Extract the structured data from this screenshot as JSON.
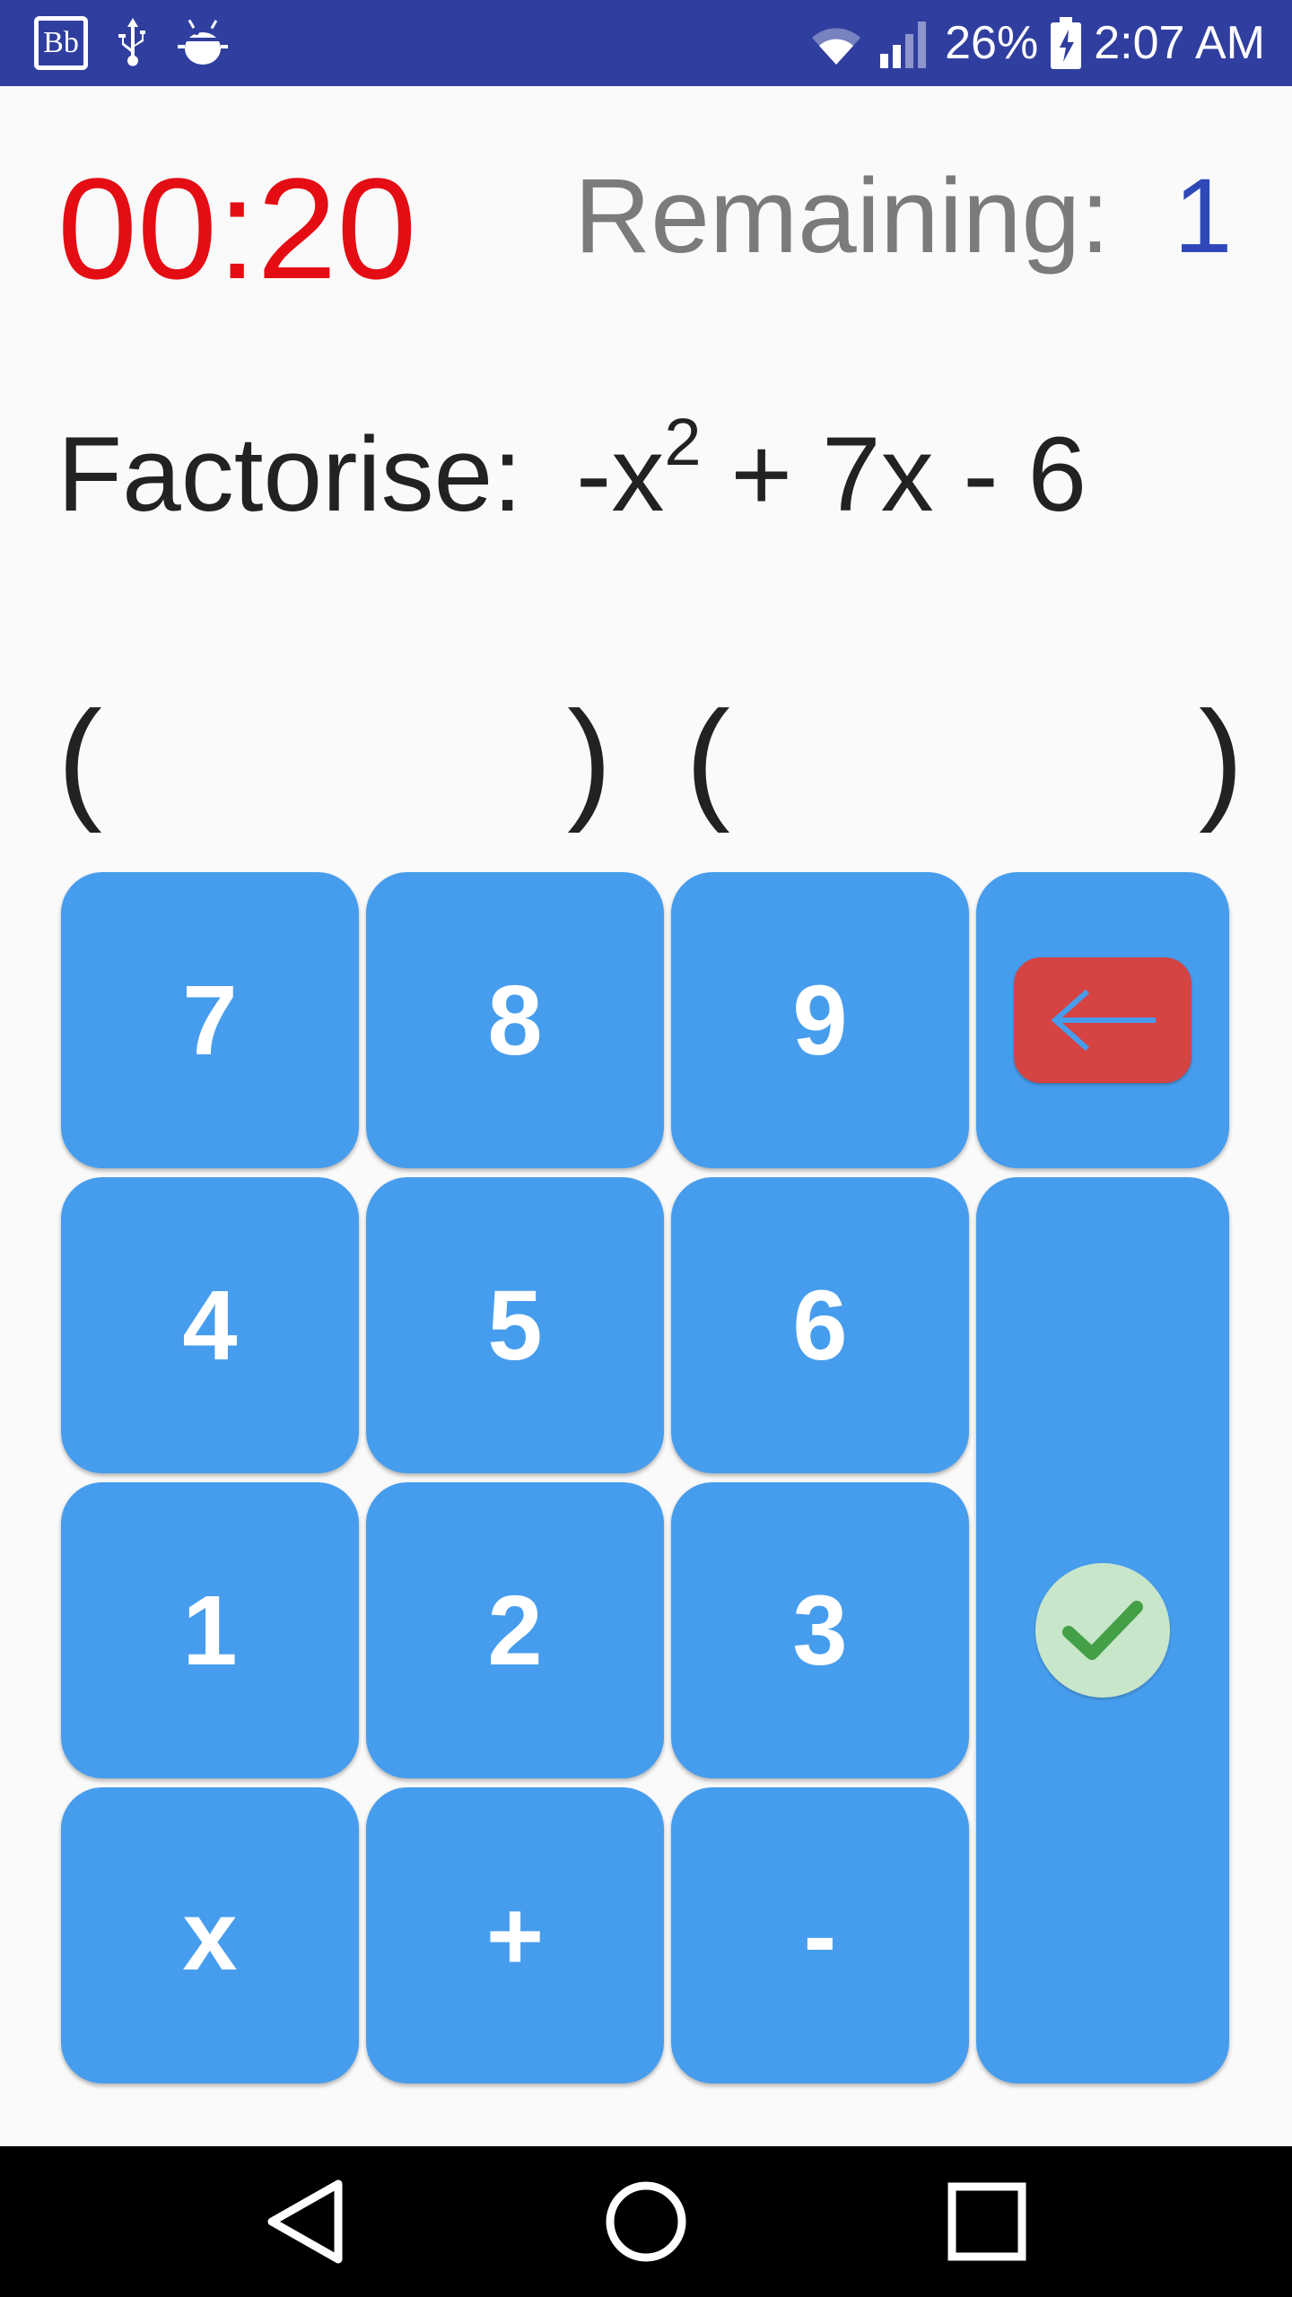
{
  "status_bar": {
    "notification_icons": [
      "blackboard-icon",
      "usb-icon",
      "android-debug-icon"
    ],
    "app_badge_text": "Bb",
    "battery_percent": "26%",
    "time": "2:07 AM"
  },
  "header": {
    "timer": "00:20",
    "remaining_label": "Remaining:",
    "remaining_value": "1"
  },
  "question": {
    "label": "Factorise:",
    "expr_lead": "-x",
    "expr_exponent": "2",
    "expr_tail": " + 7x - 6"
  },
  "answer": {
    "open_paren_1": "(",
    "close_paren_1": ")",
    "open_paren_2": "(",
    "close_paren_2": ")",
    "factor_1": "",
    "factor_2": ""
  },
  "keypad": {
    "keys": [
      "7",
      "8",
      "9",
      "4",
      "5",
      "6",
      "1",
      "2",
      "3",
      "x",
      "+",
      "-"
    ],
    "backspace_icon": "backspace-arrow-icon",
    "submit_icon": "check-icon"
  },
  "colors": {
    "status_bar": "#303f9f",
    "timer": "#e50d14",
    "remaining_value": "#2e48b8",
    "key": "#479ded",
    "backspace": "#d54342",
    "check_bg": "#c8e6c9",
    "check_mark": "#43a047"
  },
  "nav_bar": {
    "icons": [
      "back-icon",
      "home-icon",
      "recents-icon"
    ]
  }
}
